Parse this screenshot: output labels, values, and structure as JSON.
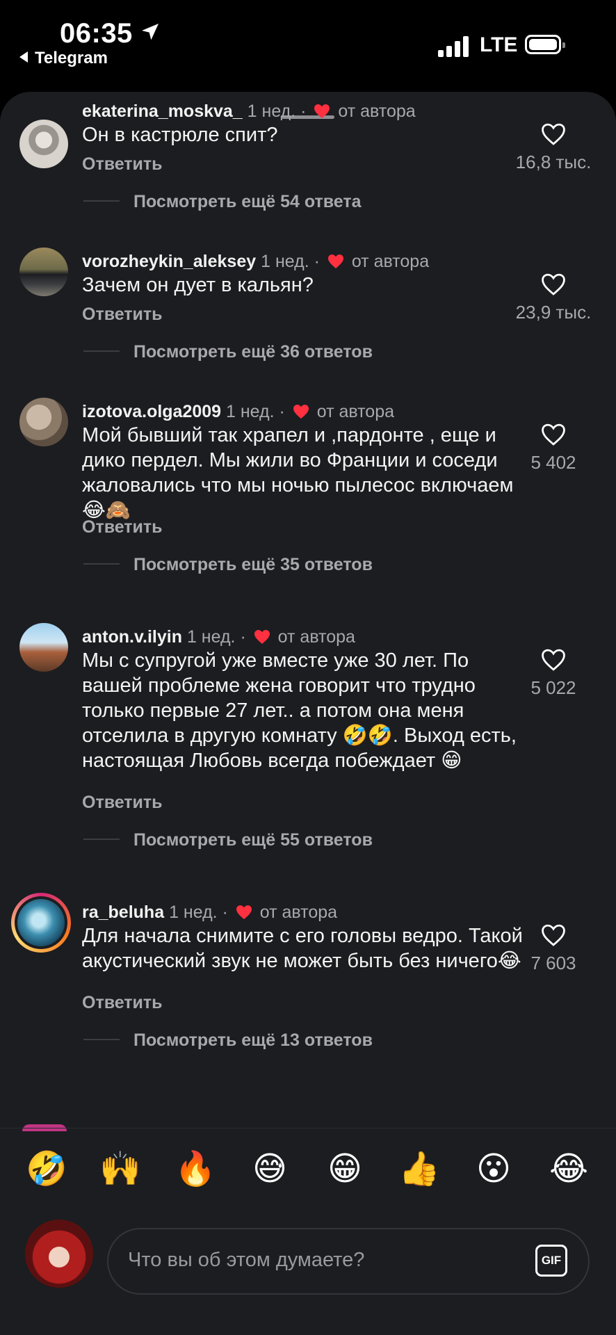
{
  "status_bar": {
    "time": "06:35",
    "back_app": "Telegram",
    "network": "LTE",
    "icons": [
      "location-arrow-icon",
      "signal-icon",
      "battery-icon"
    ]
  },
  "comments": [
    {
      "username": "ekaterina_moskva_",
      "time": "1 нед.",
      "author_like": "от автора",
      "text": "Он в кастрюле спит?",
      "reply": "Ответить",
      "likes": "16,8 тыс.",
      "more": "Посмотреть ещё 54 ответа"
    },
    {
      "username": "vorozheykin_aleksey",
      "time": "1 нед.",
      "author_like": "от автора",
      "text": "Зачем он дует в кальян?",
      "reply": "Ответить",
      "likes": "23,9 тыс.",
      "more": "Посмотреть ещё 36 ответов"
    },
    {
      "username": "izotova.olga2009",
      "time": "1 нед.",
      "author_like": "от автора",
      "text": "Мой бывший так храпел и ,пардонте , еще и дико пердел. Мы жили во Франции и соседи жаловались что мы ночью пылесос включаем😂🙈",
      "reply": "Ответить",
      "likes": "5 402",
      "more": "Посмотреть ещё 35 ответов"
    },
    {
      "username": "anton.v.ilyin",
      "time": "1 нед.",
      "author_like": "от автора",
      "text": "Мы с супругой уже вместе уже 30 лет. По вашей проблеме жена говорит что трудно только первые 27 лет.. а потом она меня отселила в другую комнату 🤣🤣. Выход есть, настоящая Любовь всегда побеждает 😁",
      "reply": "Ответить",
      "likes": "5 022",
      "more": "Посмотреть ещё 55 ответов"
    },
    {
      "username": "ra_beluha",
      "time": "1 нед.",
      "author_like": "от автора",
      "text": "Для начала снимите с его головы ведро. Такой акустический звук не может быть без ничего😂",
      "reply": "Ответить",
      "likes": "7 603",
      "more": "Посмотреть ещё 13 ответов"
    }
  ],
  "quick_emojis": [
    "🤣",
    "🙌",
    "🔥",
    "😅",
    "😁",
    "👍",
    "😮",
    "😂"
  ],
  "composer": {
    "placeholder": "Что вы об этом думаете?",
    "gif_label": "GIF"
  },
  "colors": {
    "sheet_bg": "#1c1d20",
    "secondary_text": "#a8a8ad",
    "heart_red": "#ff3040"
  }
}
